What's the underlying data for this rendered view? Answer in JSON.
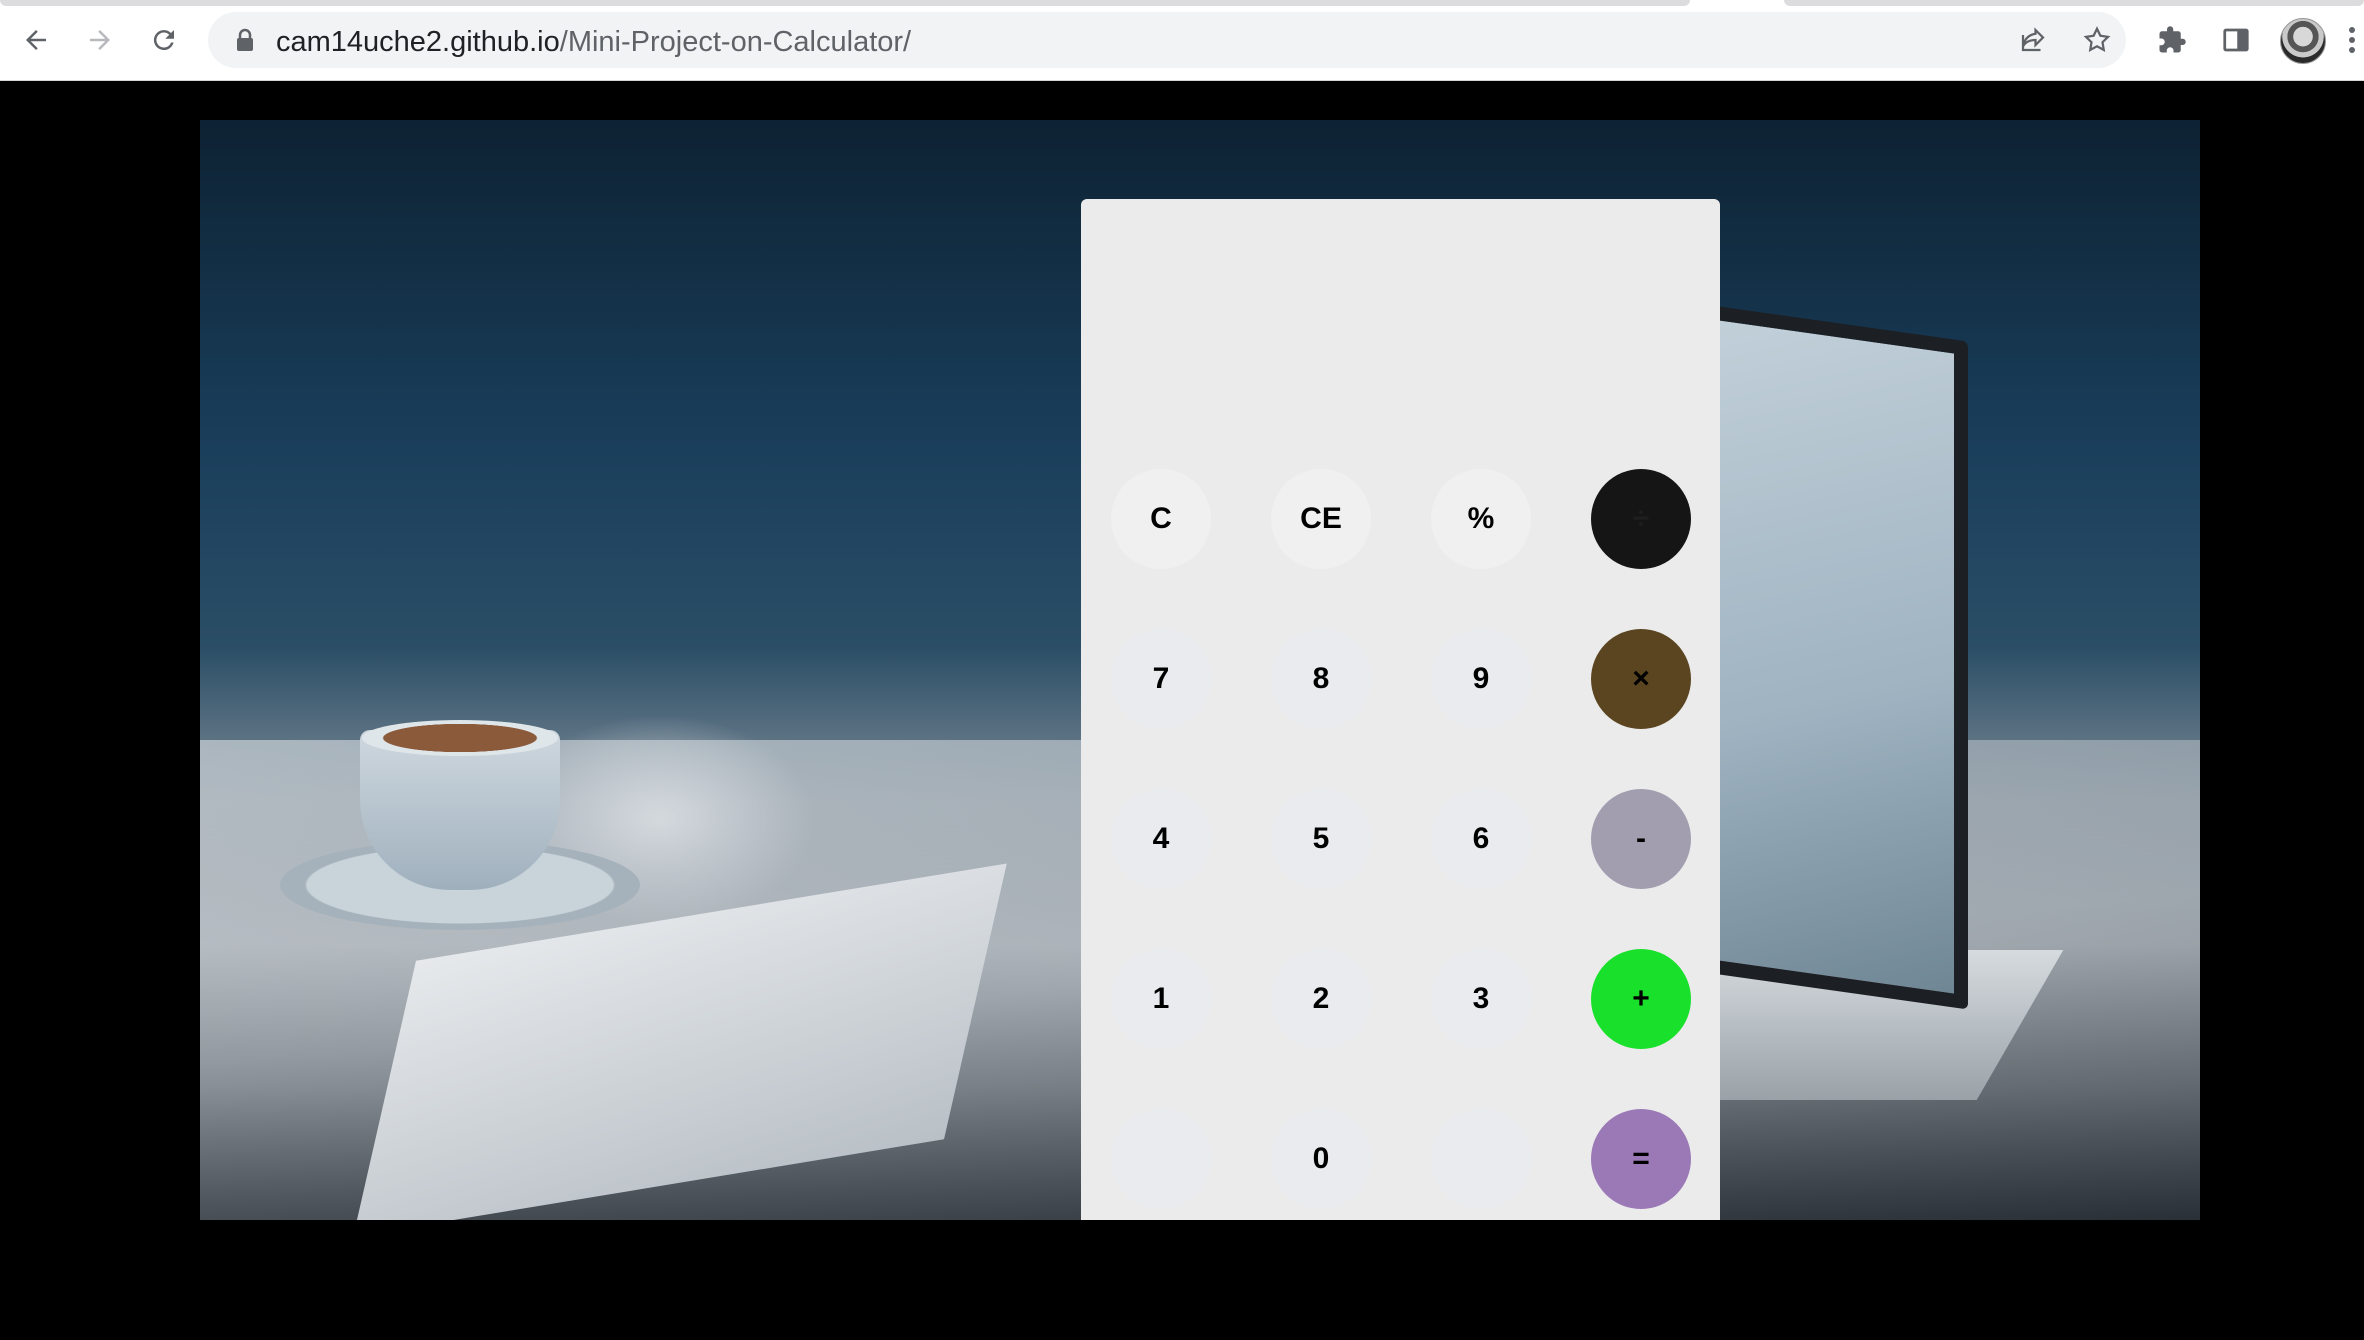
{
  "browser": {
    "url_host": "cam14uche2.github.io",
    "url_path": "/Mini-Project-on-Calculator/",
    "icons": [
      "back-arrow-icon",
      "forward-arrow-icon",
      "reload-icon",
      "lock-icon",
      "share-icon",
      "star-icon",
      "extensions-icon",
      "side-panel-icon",
      "profile-avatar",
      "menu-icon"
    ]
  },
  "calculator": {
    "display_value": "",
    "keys": {
      "clear": "C",
      "clear_entry": "CE",
      "percent": "%",
      "divide": "÷",
      "seven": "7",
      "eight": "8",
      "nine": "9",
      "multiply": "×",
      "four": "4",
      "five": "5",
      "six": "6",
      "subtract": "-",
      "one": "1",
      "two": "2",
      "three": "3",
      "add": "+",
      "blank_left": "",
      "zero": "0",
      "blank_right": "",
      "equals": "="
    },
    "colors": {
      "panel": "#ebebeb",
      "divide": "#151515",
      "multiply": "#5b4521",
      "subtract": "#a29eb0",
      "add": "#19e02a",
      "equals": "#9b79b7"
    }
  }
}
